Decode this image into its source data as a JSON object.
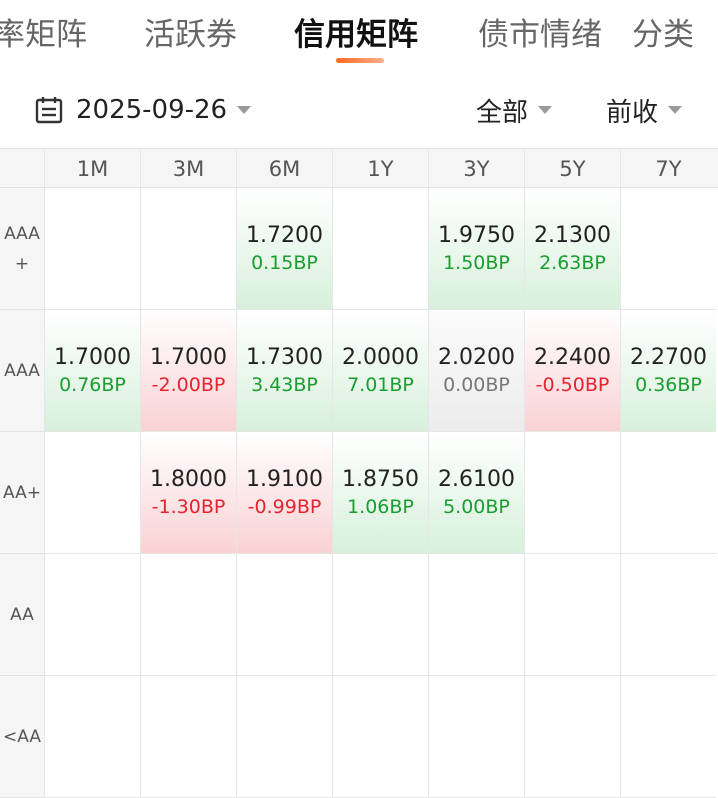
{
  "tabs": [
    {
      "label": "率矩阵",
      "active": false
    },
    {
      "label": "活跃券",
      "active": false
    },
    {
      "label": "信用矩阵",
      "active": true
    },
    {
      "label": "债市情绪",
      "active": false
    },
    {
      "label": "分类",
      "active": false
    }
  ],
  "filters": {
    "date": "2025-09-26",
    "date_icon": "calendar-icon",
    "category": "全部",
    "basis": "前收"
  },
  "matrix": {
    "columns": [
      "1M",
      "3M",
      "6M",
      "1Y",
      "3Y",
      "5Y",
      "7Y"
    ],
    "rows": [
      {
        "label": "AAA\n+",
        "cells": [
          null,
          null,
          {
            "value": "1.7200",
            "change": "0.15BP",
            "trend": "up"
          },
          null,
          {
            "value": "1.9750",
            "change": "1.50BP",
            "trend": "up"
          },
          {
            "value": "2.1300",
            "change": "2.63BP",
            "trend": "up"
          },
          null
        ]
      },
      {
        "label": "AAA",
        "cells": [
          {
            "value": "1.7000",
            "change": "0.76BP",
            "trend": "up"
          },
          {
            "value": "1.7000",
            "change": "-2.00BP",
            "trend": "down"
          },
          {
            "value": "1.7300",
            "change": "3.43BP",
            "trend": "up"
          },
          {
            "value": "2.0000",
            "change": "7.01BP",
            "trend": "up"
          },
          {
            "value": "2.0200",
            "change": "0.00BP",
            "trend": "flat"
          },
          {
            "value": "2.2400",
            "change": "-0.50BP",
            "trend": "down"
          },
          {
            "value": "2.2700",
            "change": "0.36BP",
            "trend": "up"
          }
        ]
      },
      {
        "label": "AA+",
        "cells": [
          null,
          {
            "value": "1.8000",
            "change": "-1.30BP",
            "trend": "down"
          },
          {
            "value": "1.9100",
            "change": "-0.99BP",
            "trend": "down"
          },
          {
            "value": "1.8750",
            "change": "1.06BP",
            "trend": "up"
          },
          {
            "value": "2.6100",
            "change": "5.00BP",
            "trend": "up"
          },
          null,
          null
        ]
      },
      {
        "label": "AA",
        "cells": [
          null,
          null,
          null,
          null,
          null,
          null,
          null
        ]
      },
      {
        "label": "<AA",
        "cells": [
          null,
          null,
          null,
          null,
          null,
          null,
          null
        ]
      }
    ]
  },
  "colors": {
    "up": "#1a9e2f",
    "down": "#e8232f",
    "flat": "#777777",
    "accent": "#ff6a1f"
  }
}
